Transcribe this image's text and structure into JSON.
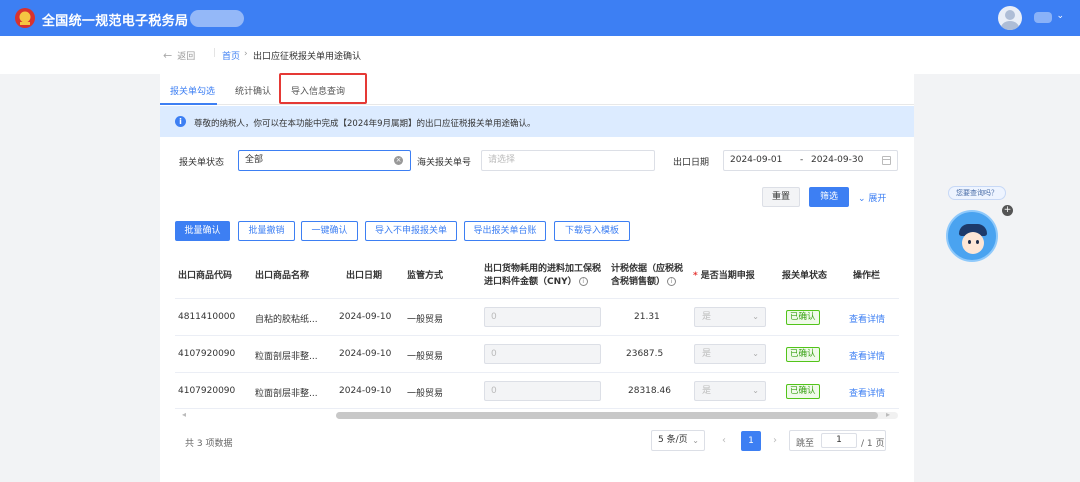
{
  "header": {
    "brand": "全国统一规范电子税务局",
    "user_chevron": "⌄"
  },
  "breadcrumb": {
    "back": "返回",
    "home": "首页",
    "separator": "›",
    "current": "出口应征税报关单用途确认"
  },
  "tabs": [
    {
      "label": "报关单勾选"
    },
    {
      "label": "统计确认"
    },
    {
      "label": "导入信息查询"
    }
  ],
  "notice": {
    "icon": "i",
    "text": "尊敬的纳税人，你可以在本功能中完成【2024年9月属期】的出口应征税报关单用途确认。"
  },
  "filters": {
    "status_label": "报关单状态",
    "status_value": "全部",
    "customs_label": "海关报关单号",
    "customs_placeholder": "请选择",
    "date_label": "出口日期",
    "date_start": "2024-09-01",
    "date_sep": "-",
    "date_end": "2024-09-30"
  },
  "filter_buttons": {
    "reset": "重置",
    "search": "筛选",
    "expand": "展开"
  },
  "actions": [
    {
      "label": "批量确认"
    },
    {
      "label": "批量撤销"
    },
    {
      "label": "一键确认"
    },
    {
      "label": "导入不申报报关单"
    },
    {
      "label": "导出报关单台账"
    },
    {
      "label": "下载导入模板"
    }
  ],
  "table": {
    "columns": {
      "code": "出口商品代码",
      "name": "出口商品名称",
      "date": "出口日期",
      "mode": "监管方式",
      "amount_line1": "出口货物耗用的进料加工保税",
      "amount_line2": "进口料件金额（CNY）",
      "basis_line1": "计税依据（应税税",
      "basis_line2": "含税销售额）",
      "declare": "是否当期申报",
      "status": "报关单状态",
      "ops": "操作栏"
    },
    "rows": [
      {
        "code": "4811410000",
        "name": "自粘的胶粘纸...",
        "date": "2024-09-10",
        "mode": "一般贸易",
        "amount": "0",
        "basis": "21.31",
        "declare": "是",
        "status": "已确认",
        "op": "查看详情"
      },
      {
        "code": "4107920090",
        "name": "粒面剖层非整...",
        "date": "2024-09-10",
        "mode": "一般贸易",
        "amount": "0",
        "basis": "23687.5",
        "declare": "是",
        "status": "已确认",
        "op": "查看详情"
      },
      {
        "code": "4107920090",
        "name": "粒面剖层非整...",
        "date": "2024-09-10",
        "mode": "一般贸易",
        "amount": "0",
        "basis": "28318.46",
        "declare": "是",
        "status": "已确认",
        "op": "查看详情"
      }
    ]
  },
  "pagination": {
    "total": "共 3 项数据",
    "page_size": "5 条/页",
    "current_page": "1",
    "jump_label": "跳至",
    "jump_value": "1",
    "total_pages": "/ 1 页",
    "prev": "‹",
    "next": "›"
  },
  "helper": {
    "tip": "您要查询吗？",
    "close": "+"
  },
  "colors": {
    "primary": "#3d7ff3",
    "notice_bg": "#dcebff",
    "highlight": "#e53935",
    "success": "#52c41a"
  }
}
